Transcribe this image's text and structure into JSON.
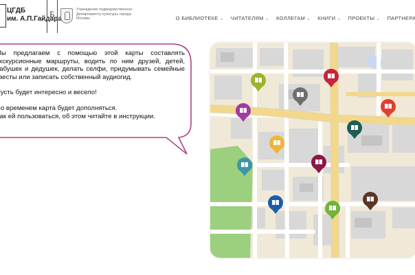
{
  "header": {
    "logo_line1": "ЦГДБ",
    "logo_line2": "им. А.П.Гайдара",
    "bookmark_letter": "Б",
    "org_text": "Учреждение подведомственное Департаменту культуры города Москвы"
  },
  "nav": {
    "items": [
      {
        "label": "О БИБЛИОТЕКЕ"
      },
      {
        "label": "ЧИТАТЕЛЯМ"
      },
      {
        "label": "КОЛЛЕГАМ"
      },
      {
        "label": "КНИГИ"
      },
      {
        "label": "ПРОЕКТЫ"
      },
      {
        "label": "ПАРТНЕРАМ"
      }
    ]
  },
  "bubble": {
    "p1": "Мы предлагаем с помощью этой карты составлять экскурсионные маршруты, водить по ним друзей, детей, бабушек и дедушек, делать селфи, придумывать семейные квесты или записать собственный аудиогид.",
    "p2": "Пусть будет интересно и весело!",
    "p3": "Со временем карта будет дополняться.",
    "p4": "Как ей пользоваться, об этом читайте в инструкции."
  },
  "map": {
    "colors": {
      "bg": "#f1e9d7",
      "block": "#d6d6d6",
      "road": "#ffffff",
      "main_road": "#f3d88a",
      "park": "#9ccf7e",
      "water": "#c7d9f0",
      "bubble_border": "#b0407e"
    },
    "pins": [
      {
        "name": "pin-olive",
        "color": "#9bb42b"
      },
      {
        "name": "pin-red-top",
        "color": "#c8243b"
      },
      {
        "name": "pin-grey",
        "color": "#6e6e6e"
      },
      {
        "name": "pin-purple",
        "color": "#a23aa3"
      },
      {
        "name": "pin-red-right",
        "color": "#e0402e"
      },
      {
        "name": "pin-teal-dark",
        "color": "#1f5c56"
      },
      {
        "name": "pin-yellow",
        "color": "#f0b43a"
      },
      {
        "name": "pin-teal",
        "color": "#3e97a4"
      },
      {
        "name": "pin-maroon",
        "color": "#8b1846"
      },
      {
        "name": "pin-blue",
        "color": "#1e5ca8"
      },
      {
        "name": "pin-green",
        "color": "#6fb43b"
      },
      {
        "name": "pin-brown",
        "color": "#5c3625"
      }
    ]
  }
}
